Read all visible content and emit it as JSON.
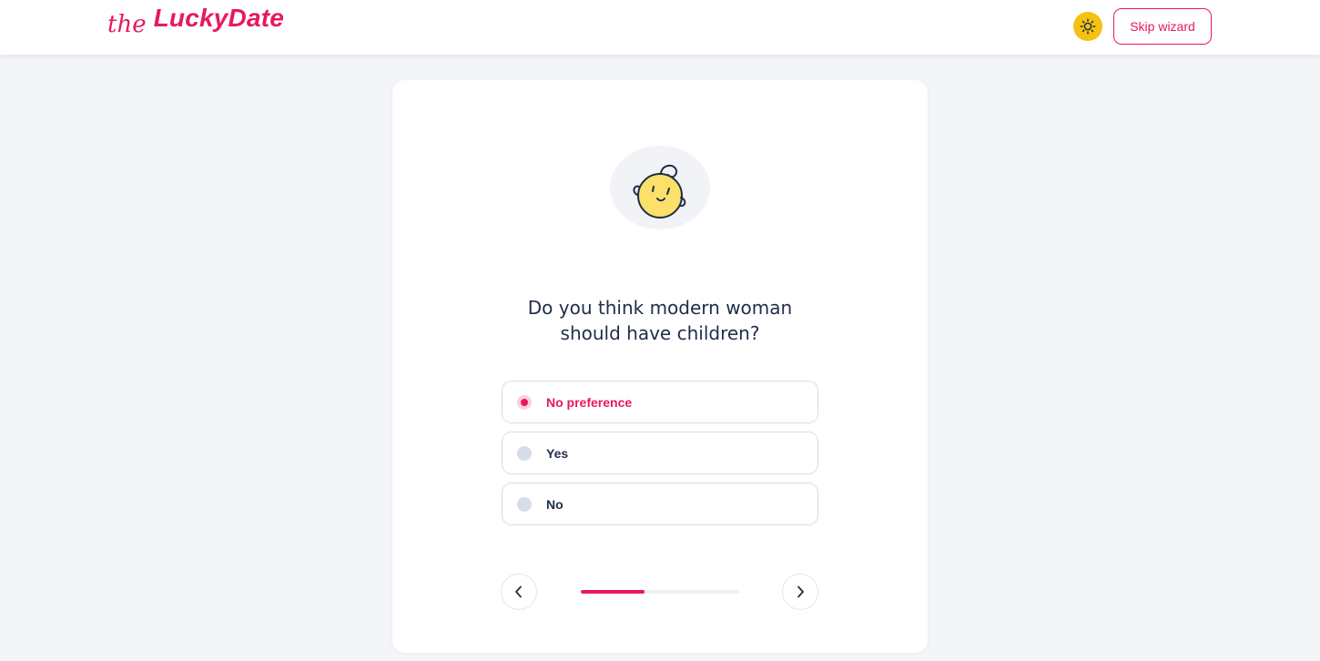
{
  "header": {
    "logo_prefix": "the",
    "logo_name": "LuckyDate",
    "theme_icon": "sun-icon",
    "skip_label": "Skip wizard"
  },
  "wizard": {
    "illustration": "baby-face-icon",
    "question_line1": "Do you think modern woman",
    "question_line2": "should have children?",
    "options": [
      {
        "label": "No preference",
        "selected": true
      },
      {
        "label": "Yes",
        "selected": false
      },
      {
        "label": "No",
        "selected": false
      }
    ],
    "progress_fraction": 0.4,
    "prev_icon": "chevron-left-icon",
    "next_icon": "chevron-right-icon"
  },
  "colors": {
    "brand": "#e8185f",
    "theme_toggle": "#f5c211",
    "text": "#1f2d4a",
    "background": "#f3f5f9"
  }
}
